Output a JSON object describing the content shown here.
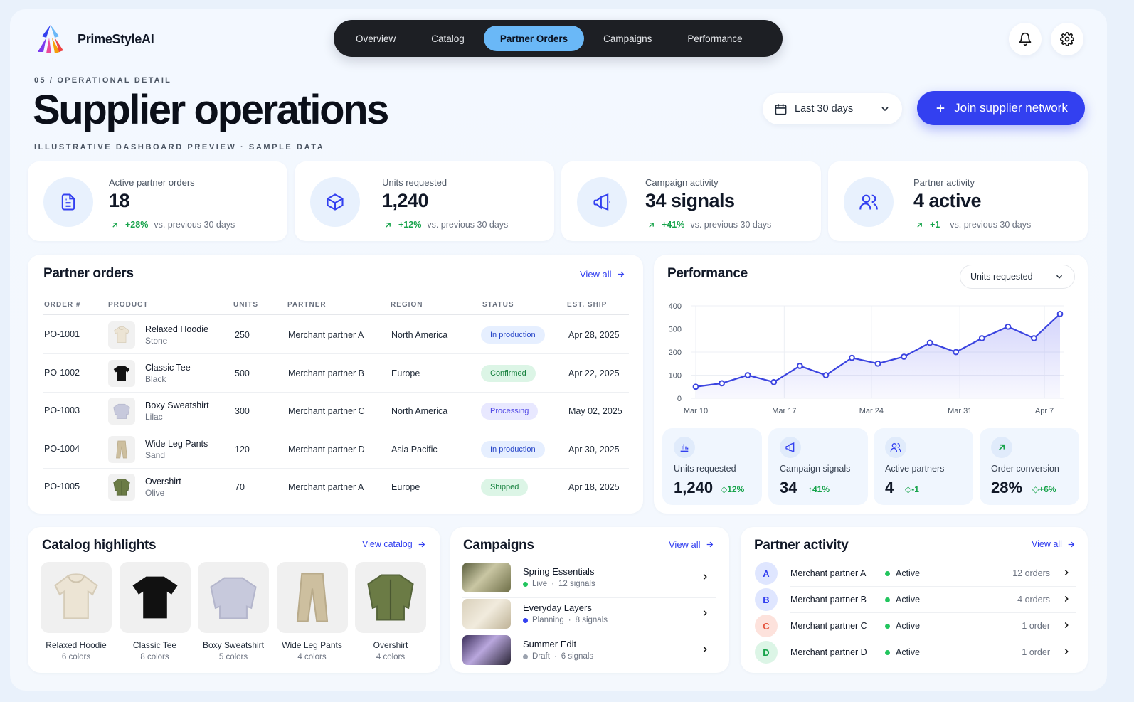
{
  "brand": {
    "name": "PrimeStyleAI"
  },
  "nav": {
    "tabs": [
      {
        "label": "Overview"
      },
      {
        "label": "Catalog"
      },
      {
        "label": "Partner Orders",
        "active": true
      },
      {
        "label": "Campaigns"
      },
      {
        "label": "Performance"
      }
    ]
  },
  "header": {
    "eyebrow": "05 / OPERATIONAL DETAIL",
    "title": "Supplier operations",
    "subtitle": "ILLUSTRATIVE DASHBOARD PREVIEW · SAMPLE DATA",
    "date_range": "Last 30 days",
    "cta": "Join supplier network"
  },
  "stats": [
    {
      "label": "Active partner orders",
      "value": "18",
      "delta": "+28%",
      "note": "vs. previous 30 days",
      "icon": "document-icon"
    },
    {
      "label": "Units requested",
      "value": "1,240",
      "delta": "+12%",
      "note": "vs. previous 30 days",
      "icon": "box-icon"
    },
    {
      "label": "Campaign activity",
      "value": "34 signals",
      "delta": "+41%",
      "note": "vs. previous 30 days",
      "icon": "megaphone-icon"
    },
    {
      "label": "Partner activity",
      "value": "4 active",
      "delta": "+1",
      "note": "vs. previous 30 days",
      "icon": "users-icon"
    }
  ],
  "orders": {
    "title": "Partner orders",
    "view_all": "View all",
    "columns": [
      "ORDER #",
      "PRODUCT",
      "UNITS",
      "PARTNER",
      "REGION",
      "STATUS",
      "EST. SHIP"
    ],
    "rows": [
      {
        "id": "PO-1001",
        "product": "Relaxed Hoodie",
        "color": "Stone",
        "units": "250",
        "partner": "Merchant partner A",
        "region": "North America",
        "status": "In production",
        "ship": "Apr 28, 2025"
      },
      {
        "id": "PO-1002",
        "product": "Classic Tee",
        "color": "Black",
        "units": "500",
        "partner": "Merchant partner B",
        "region": "Europe",
        "status": "Confirmed",
        "ship": "Apr 22, 2025"
      },
      {
        "id": "PO-1003",
        "product": "Boxy Sweatshirt",
        "color": "Lilac",
        "units": "300",
        "partner": "Merchant partner C",
        "region": "North America",
        "status": "Processing",
        "ship": "May 02, 2025"
      },
      {
        "id": "PO-1004",
        "product": "Wide Leg Pants",
        "color": "Sand",
        "units": "120",
        "partner": "Merchant partner D",
        "region": "Asia Pacific",
        "status": "In production",
        "ship": "Apr 30, 2025"
      },
      {
        "id": "PO-1005",
        "product": "Overshirt",
        "color": "Olive",
        "units": "70",
        "partner": "Merchant partner A",
        "region": "Europe",
        "status": "Shipped",
        "ship": "Apr 18, 2025"
      }
    ]
  },
  "performance": {
    "title": "Performance",
    "metric_select": "Units requested",
    "minis": [
      {
        "label": "Units requested",
        "value": "1,240",
        "delta": "12%",
        "icon": "bar-chart-icon"
      },
      {
        "label": "Campaign signals",
        "value": "34",
        "delta": "41%",
        "icon": "megaphone-icon"
      },
      {
        "label": "Active partners",
        "value": "4",
        "delta": "1",
        "icon": "users-icon"
      },
      {
        "label": "Order conversion",
        "value": "28%",
        "delta": "+6%",
        "icon": "trend-arrow-icon"
      }
    ]
  },
  "chart_data": {
    "type": "area",
    "ylim": [
      0,
      400
    ],
    "yticks": [
      0,
      100,
      200,
      300,
      400
    ],
    "xticks": [
      "Mar 10",
      "Mar 17",
      "Mar 24",
      "Mar 31",
      "Apr 7"
    ],
    "x": [
      "Mar 10",
      "Mar 12",
      "Mar 14",
      "Mar 16",
      "Mar 18",
      "Mar 20",
      "Mar 23",
      "Mar 25",
      "Mar 27",
      "Mar 29",
      "Mar 31",
      "Apr 2",
      "Apr 4",
      "Apr 6",
      "Apr 8"
    ],
    "values": [
      50,
      65,
      100,
      70,
      140,
      100,
      175,
      150,
      180,
      240,
      200,
      260,
      310,
      260,
      365
    ],
    "color": "#3b44e0"
  },
  "catalog": {
    "title": "Catalog highlights",
    "view_link": "View catalog",
    "items": [
      {
        "name": "Relaxed Hoodie",
        "sub": "6 colors"
      },
      {
        "name": "Classic Tee",
        "sub": "8 colors"
      },
      {
        "name": "Boxy Sweatshirt",
        "sub": "5 colors"
      },
      {
        "name": "Wide Leg Pants",
        "sub": "4 colors"
      },
      {
        "name": "Overshirt",
        "sub": "4 colors"
      }
    ]
  },
  "campaigns": {
    "title": "Campaigns",
    "view_all": "View all",
    "items": [
      {
        "name": "Spring Essentials",
        "status": "Live",
        "signals": "12 signals",
        "dot": "#22c55e"
      },
      {
        "name": "Everyday Layers",
        "status": "Planning",
        "signals": "8 signals",
        "dot": "#3340f0"
      },
      {
        "name": "Summer Edit",
        "status": "Draft",
        "signals": "6 signals",
        "dot": "#9ca3af"
      }
    ]
  },
  "partners": {
    "title": "Partner activity",
    "view_all": "View all",
    "items": [
      {
        "initial": "A",
        "name": "Merchant partner A",
        "status": "Active",
        "count": "12 orders",
        "color": "#3340f0",
        "bg": "#dfe6ff"
      },
      {
        "initial": "B",
        "name": "Merchant partner B",
        "status": "Active",
        "count": "4 orders",
        "color": "#3340f0",
        "bg": "#dfe6ff"
      },
      {
        "initial": "C",
        "name": "Merchant partner C",
        "status": "Active",
        "count": "1 order",
        "color": "#e5533d",
        "bg": "#fde2dc"
      },
      {
        "initial": "D",
        "name": "Merchant partner D",
        "status": "Active",
        "count": "1 order",
        "color": "#16a34a",
        "bg": "#dcf5e6"
      }
    ]
  }
}
